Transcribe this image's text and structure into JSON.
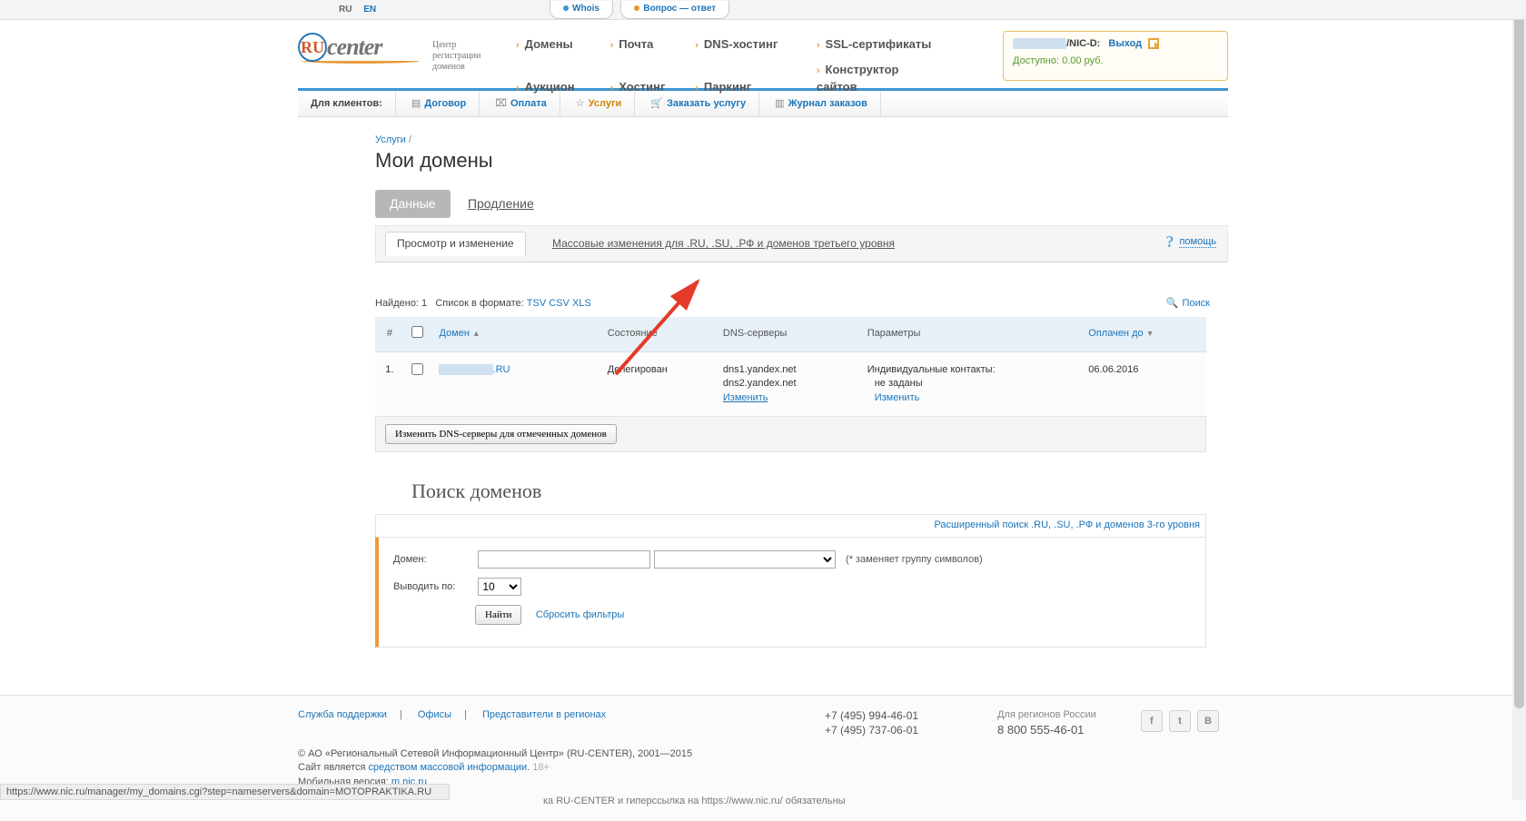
{
  "lang": {
    "ru": "RU",
    "en": "EN"
  },
  "toptabs": {
    "whois": "Whois",
    "faq": "Вопрос — ответ"
  },
  "logo": {
    "ball": "RU",
    "word": "center",
    "sub": "Центр\nрегистрации\nдоменов"
  },
  "menu": {
    "r1": [
      "Домены",
      "Почта",
      "DNS-хостинг",
      "SSL-сертификаты"
    ],
    "r2": [
      "Аукцион",
      "Хостинг",
      "Паркинг",
      "Конструктор сайтов"
    ]
  },
  "user": {
    "mask": " ",
    "nic": "/NIC-D:",
    "logout": "Выход",
    "balance": "Доступно: 0.00 руб."
  },
  "subnav": {
    "clients": "Для клиентов:",
    "items": [
      "Договор",
      "Оплата",
      "Услуги",
      "Заказать услугу",
      "Журнал заказов"
    ]
  },
  "bc": {
    "link": "Услуги",
    "sep": " /"
  },
  "h1": "Мои домены",
  "tabs1": {
    "on": "Данные",
    "off": "Продление"
  },
  "tabs2": {
    "on": "Просмотр и изменение",
    "off": "Массовые изменения для .RU, .SU, .РФ и доменов третьего уровня"
  },
  "help": "помощь",
  "found": {
    "label": "Найдено: ",
    "count": "1",
    "listfmt": "Список в формате:",
    "formats": [
      "TSV",
      "CSV",
      "XLS"
    ],
    "search": "Поиск"
  },
  "cols": {
    "n": "#",
    "domain": "Домен",
    "state": "Состояние",
    "dns": "DNS-серверы",
    "params": "Параметры",
    "paid": "Оплачен до"
  },
  "row": {
    "n": "1.",
    "domain_suffix": ".RU",
    "state": "Делегирован",
    "dns1": "dns1.yandex.net",
    "dns2": "dns2.yandex.net",
    "dns_change": "Изменить",
    "p1": "Индивидуальные контакты:",
    "p2": "не заданы",
    "p_change": "Изменить",
    "paid": "06.06.2016"
  },
  "bulkbtn": "Изменить DNS-серверы для отмеченных доменов",
  "search": {
    "h": "Поиск доменов",
    "ext": "Расширенный поиск .RU, .SU, .РФ и доменов 3-го уровня",
    "l_domain": "Домен:",
    "hint": "(* заменяет группу символов)",
    "l_per": "Выводить по:",
    "per_value": "10",
    "submit": "Найти",
    "reset": "Сбросить фильтры"
  },
  "footer": {
    "links": [
      "Служба поддержки",
      "Офисы",
      "Представители в регионах"
    ],
    "ph1": "+7 (495) 994-46-01",
    "ph2": "+7 (495) 737-06-01",
    "reg1": "Для регионов России",
    "reg2": "8 800 555-46-01",
    "copy1": "© АО «Региональный Сетевой Информационный Центр» (RU-CENTER), 2001—2015",
    "copy2a": "Сайт является ",
    "copy2b": "средством массовой информации.",
    "copy2c": " 18+",
    "copy3a": "Мобильная версия: ",
    "copy3b": "m.nic.ru",
    "copy4": "ка RU-CENTER и гиперссылка на https://www.nic.ru/ обязательны"
  },
  "status": "https://www.nic.ru/manager/my_domains.cgi?step=nameservers&domain=MOTOPRAKTIKA.RU"
}
